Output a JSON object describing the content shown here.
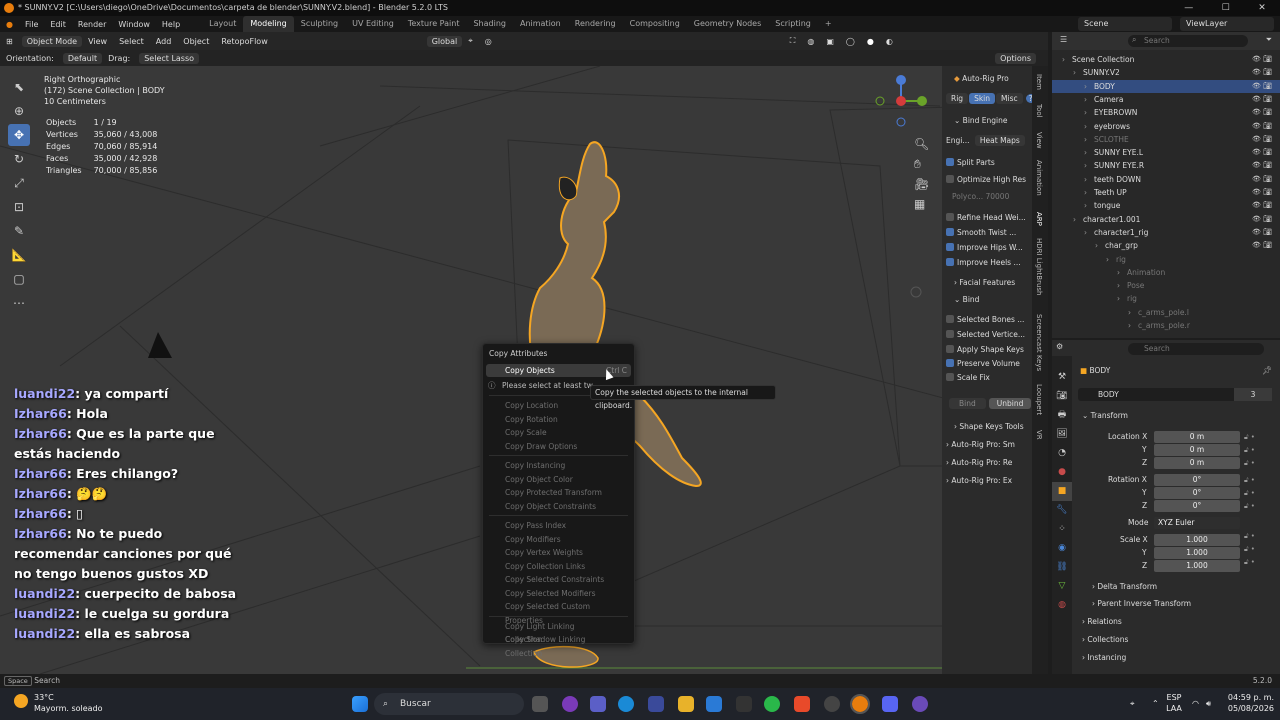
{
  "window": {
    "title": "* SUNNY.V2 [C:\\Users\\diego\\OneDrive\\Documentos\\carpeta de blender\\SUNNY.V2.blend] - Blender 5.2.0 LTS"
  },
  "menu": [
    "File",
    "Edit",
    "Render",
    "Window",
    "Help"
  ],
  "workspaces": [
    "Layout",
    "Modeling",
    "Sculpting",
    "UV Editing",
    "Texture Paint",
    "Shading",
    "Animation",
    "Rendering",
    "Compositing",
    "Geometry Nodes",
    "Scripting"
  ],
  "active_workspace": "Modeling",
  "scene": "Scene",
  "view_layer": "ViewLayer",
  "viewport_header": {
    "mode": "Object Mode",
    "items": [
      "View",
      "Select",
      "Add",
      "Object"
    ],
    "addon": "RetopoFlow",
    "transform": "Global"
  },
  "tool_header": {
    "orientation_label": "Orientation:",
    "orientation": "Default",
    "drag_label": "Drag:",
    "drag": "Select Lasso",
    "options": "Options"
  },
  "viewport_info": {
    "view": "Right Orthographic",
    "collection": "(172) Scene Collection | BODY",
    "scale": "10 Centimeters"
  },
  "stats": [
    {
      "label": "Objects",
      "value": "1 / 19"
    },
    {
      "label": "Vertices",
      "value": "35,060 / 43,008"
    },
    {
      "label": "Edges",
      "value": "70,060 / 85,914"
    },
    {
      "label": "Faces",
      "value": "35,000 / 42,928"
    },
    {
      "label": "Triangles",
      "value": "70,000 / 85,856"
    }
  ],
  "chat": [
    {
      "name": "luandi22",
      "text": ": ya compartí"
    },
    {
      "name": "Izhar66",
      "text": ": Hola"
    },
    {
      "name": "Izhar66",
      "text": ": Que es la parte que estás haciendo"
    },
    {
      "name": "Izhar66",
      "text": ": Eres chilango?"
    },
    {
      "name": "Izhar66",
      "text": ": 🤔🤔"
    },
    {
      "name": "Izhar66",
      "text": ": ▯"
    },
    {
      "name": "Izhar66",
      "text": ": No te puedo recomendar canciones por qué no tengo buenos gustos XD"
    },
    {
      "name": "luandi22",
      "text": ": cuerpecito de babosa"
    },
    {
      "name": "luandi22",
      "text": ": le cuelga su gordura"
    },
    {
      "name": "luandi22",
      "text": ": ella es sabrosa"
    }
  ],
  "context_menu": {
    "title": "Copy Attributes",
    "first": "Copy Objects",
    "first_shortcut": "Ctrl C",
    "warning": "Please select at least tw",
    "groups": [
      [
        "Copy Location",
        "Copy Rotation",
        "Copy Scale",
        "Copy Draw Options"
      ],
      [
        "Copy Instancing",
        "Copy Object Color",
        "Copy Protected Transform",
        "Copy Object Constraints"
      ],
      [
        "Copy Pass Index",
        "Copy Modifiers",
        "Copy Vertex Weights",
        "Copy Collection Links",
        "Copy Selected Constraints",
        "Copy Selected Modifiers",
        "Copy Selected Custom Properties"
      ],
      [
        "Copy Light Linking Collection",
        "Copy Shadow Linking Collection"
      ]
    ],
    "tooltip": "Copy the selected objects to the internal clipboard."
  },
  "npanel": {
    "title": "Auto-Rig Pro",
    "tabs": [
      "Rig",
      "Skin",
      "Misc"
    ],
    "bind_engine": "Bind Engine",
    "engine_label": "Engi...",
    "engine_value": "Heat Maps",
    "split_parts": "Split Parts",
    "optimize": "Optimize High Res",
    "polycount": "Polyco... 70000",
    "checks": [
      {
        "label": "Refine Head Wei...",
        "on": false
      },
      {
        "label": "Smooth Twist ...",
        "on": true
      },
      {
        "label": "Improve Hips W...",
        "on": true
      },
      {
        "label": "Improve Heels ...",
        "on": true
      }
    ],
    "facial": "Facial Features",
    "bind": "Bind",
    "checks2": [
      {
        "label": "Selected Bones ...",
        "on": false
      },
      {
        "label": "Selected Vertice...",
        "on": false
      },
      {
        "label": "Apply Shape Keys",
        "on": false
      },
      {
        "label": "Preserve Volume",
        "on": true
      },
      {
        "label": "Scale Fix",
        "on": false
      }
    ],
    "bind_btn": "Bind",
    "unbind_btn": "Unbind",
    "shape_keys": "Shape Keys Tools",
    "subpanels": [
      "Auto-Rig Pro: Sm",
      "Auto-Rig Pro: Re",
      "Auto-Rig Pro: Ex"
    ],
    "vtabs": [
      "Item",
      "Tool",
      "View",
      "Animation",
      "ARP",
      "HDRI LightBrush",
      "Screencast Keys",
      "Looupert",
      "VR"
    ]
  },
  "outliner": {
    "search_placeholder": "Search",
    "rows": [
      {
        "label": "Scene Collection",
        "indent": 0,
        "sel": false,
        "dim": false
      },
      {
        "label": "SUNNY.V2",
        "indent": 1,
        "sel": false,
        "dim": false
      },
      {
        "label": "BODY",
        "indent": 2,
        "sel": true,
        "dim": false
      },
      {
        "label": "Camera",
        "indent": 2,
        "sel": false,
        "dim": false
      },
      {
        "label": "EYEBROWN",
        "indent": 2,
        "sel": false,
        "dim": false
      },
      {
        "label": "eyebrows",
        "indent": 2,
        "sel": false,
        "dim": false
      },
      {
        "label": "SCLOTHE",
        "indent": 2,
        "sel": false,
        "dim": true
      },
      {
        "label": "SUNNY EYE.L",
        "indent": 2,
        "sel": false,
        "dim": false
      },
      {
        "label": "SUNNY EYE.R",
        "indent": 2,
        "sel": false,
        "dim": false
      },
      {
        "label": "teeth DOWN",
        "indent": 2,
        "sel": false,
        "dim": false
      },
      {
        "label": "Teeth UP",
        "indent": 2,
        "sel": false,
        "dim": false
      },
      {
        "label": "tongue",
        "indent": 2,
        "sel": false,
        "dim": false
      },
      {
        "label": "character1.001",
        "indent": 1,
        "sel": false,
        "dim": false
      },
      {
        "label": "character1_rig",
        "indent": 2,
        "sel": false,
        "dim": false
      },
      {
        "label": "char_grp",
        "indent": 3,
        "sel": false,
        "dim": false
      },
      {
        "label": "rig",
        "indent": 4,
        "sel": false,
        "dim": true
      },
      {
        "label": "Animation",
        "indent": 5,
        "sel": false,
        "dim": true
      },
      {
        "label": "Pose",
        "indent": 5,
        "sel": false,
        "dim": true
      },
      {
        "label": "rig",
        "indent": 5,
        "sel": false,
        "dim": true
      },
      {
        "label": "c_arms_pole.l",
        "indent": 6,
        "sel": false,
        "dim": true
      },
      {
        "label": "c_arms_pole.r",
        "indent": 6,
        "sel": false,
        "dim": true
      }
    ]
  },
  "properties": {
    "search_placeholder": "Search",
    "object_name": "BODY",
    "data_name": "BODY",
    "users": "3",
    "transform": "Transform",
    "location_label": "Location X",
    "rotation_label": "Rotation X",
    "mode_label": "Mode",
    "mode_value": "XYZ Euler",
    "scale_label": "Scale X",
    "axis_y": "Y",
    "axis_z": "Z",
    "location": [
      "0 m",
      "0 m",
      "0 m"
    ],
    "rotation": [
      "0°",
      "0°",
      "0°"
    ],
    "scale": [
      "1.000",
      "1.000",
      "1.000"
    ],
    "delta": "Delta Transform",
    "parent_inverse": "Parent Inverse Transform",
    "sections": [
      "Relations",
      "Collections",
      "Instancing"
    ]
  },
  "statusbar": {
    "left": "Search",
    "key": "Space",
    "version": "5.2.0"
  },
  "taskbar": {
    "temp": "33°C",
    "weather": "Mayorm. soleado",
    "search": "Buscar",
    "lang": "ESP",
    "lang2": "LAA",
    "time": "04:59 p. m.",
    "date": "05/08/2026"
  }
}
